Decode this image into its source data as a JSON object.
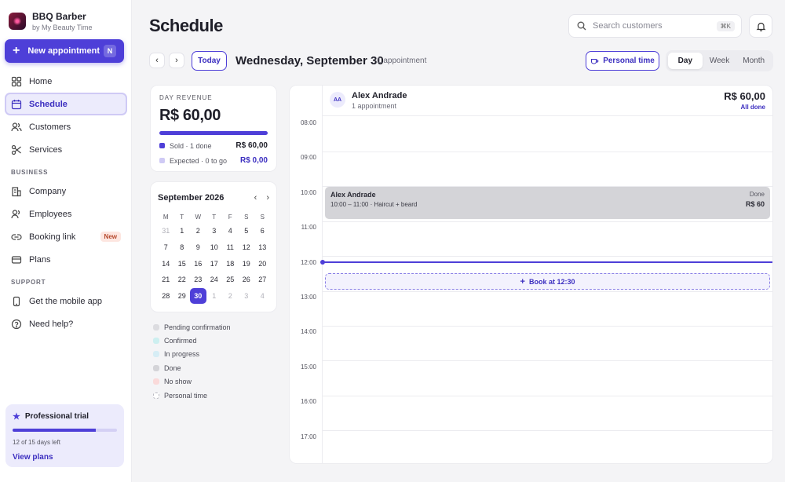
{
  "brand": {
    "name": "BBQ Barber",
    "subtitle": "by My Beauty Time"
  },
  "new_appointment": {
    "label": "New appointment",
    "shortcut": "N",
    "icon": "plus-icon"
  },
  "nav": {
    "main": [
      {
        "label": "Home",
        "icon": "home-icon"
      },
      {
        "label": "Schedule",
        "icon": "calendar-icon",
        "active": true
      },
      {
        "label": "Customers",
        "icon": "users-icon"
      },
      {
        "label": "Services",
        "icon": "scissors-icon"
      }
    ],
    "business_title": "BUSINESS",
    "business": [
      {
        "label": "Company",
        "icon": "building-icon"
      },
      {
        "label": "Employees",
        "icon": "employees-icon"
      },
      {
        "label": "Booking link",
        "icon": "link-icon",
        "badge": "New"
      },
      {
        "label": "Plans",
        "icon": "credit-card-icon"
      }
    ],
    "support_title": "SUPPORT",
    "support": [
      {
        "label": "Get the mobile app",
        "icon": "phone-icon"
      },
      {
        "label": "Need help?",
        "icon": "help-icon"
      }
    ]
  },
  "trial": {
    "title": "Professional trial",
    "progress": 0.8,
    "days_text": "12 of 15 days left",
    "link": "View plans"
  },
  "header": {
    "title": "Schedule",
    "search_placeholder": "Search customers",
    "search_shortcut": "⌘K"
  },
  "toolbar": {
    "today_label": "Today",
    "date_title": "Wednesday, September 30",
    "appointment_count": "1 appointment",
    "personal_time_label": "Personal time",
    "views": [
      "Day",
      "Week",
      "Month"
    ],
    "active_view": "Day"
  },
  "revenue": {
    "label": "DAY REVENUE",
    "value": "R$ 60,00",
    "sold_fraction": 1.0,
    "sold_label": "Sold · 1 done",
    "sold_amount": "R$ 60,00",
    "expected_label": "Expected · 0 to go",
    "expected_amount": "R$ 0,00"
  },
  "mini_calendar": {
    "title": "September 2026",
    "weekdays": [
      "M",
      "T",
      "W",
      "T",
      "F",
      "S",
      "S"
    ],
    "weeks": [
      [
        31,
        1,
        2,
        3,
        4,
        5,
        6
      ],
      [
        7,
        8,
        9,
        10,
        11,
        12,
        13
      ],
      [
        14,
        15,
        16,
        17,
        18,
        19,
        20
      ],
      [
        21,
        22,
        23,
        24,
        25,
        26,
        27
      ],
      [
        28,
        29,
        30,
        1,
        2,
        3,
        4
      ]
    ],
    "selected": 30
  },
  "legend": [
    {
      "label": "Pending confirmation",
      "color": "#dcdce0"
    },
    {
      "label": "Confirmed",
      "color": "#cdeff0"
    },
    {
      "label": "In progress",
      "color": "#d6edf5"
    },
    {
      "label": "Done",
      "color": "#d4d4d8"
    },
    {
      "label": "No show",
      "color": "#fadada"
    },
    {
      "label": "Personal time",
      "color": "dashed"
    }
  ],
  "staff": {
    "initials": "AA",
    "name": "Alex Andrade",
    "sub": "1 appointment",
    "total": "R$ 60,00",
    "status": "All done"
  },
  "hours": [
    "08:00",
    "09:00",
    "10:00",
    "11:00",
    "12:00",
    "13:00",
    "14:00",
    "15:00",
    "16:00",
    "17:00"
  ],
  "event": {
    "name": "Alex Andrade",
    "detail": "10:00 – 11:00 · Haircut + beard",
    "status": "Done",
    "price": "R$ 60"
  },
  "book_slot": {
    "label": "Book at 12:30"
  },
  "colors": {
    "accent": "#4e3fd8",
    "accent_soft": "#ecebfc"
  }
}
